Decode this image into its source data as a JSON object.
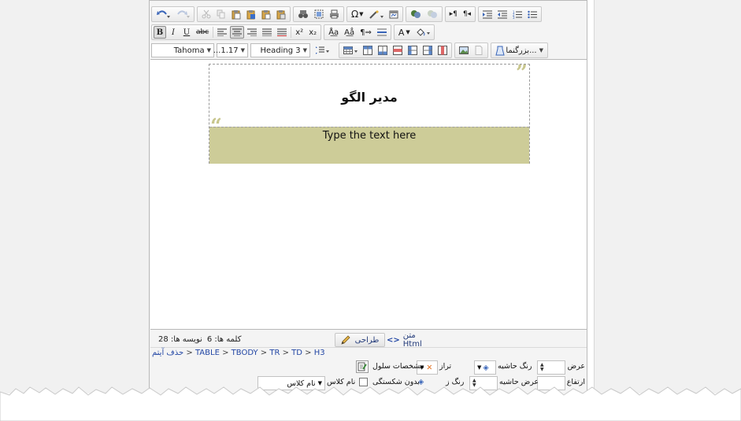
{
  "toolbar": {
    "row3": {
      "font_name": "Tahoma",
      "line_height": "...1.17",
      "heading": "Heading 3",
      "magnify": "بزرگنما..."
    }
  },
  "content": {
    "heading": "مدیر الگو",
    "cell_text": "Type the text here"
  },
  "status": {
    "word_count_label": "کلمه ها:",
    "word_count": "6",
    "char_count_label": "نویسه ها:",
    "char_count": "28",
    "design_label": "طراحی",
    "html_label": "متن Html"
  },
  "breadcrumb": {
    "remove_label": "حذف آیتم",
    "path": [
      "TABLE",
      "TBODY",
      "TR",
      "TD",
      "H3"
    ]
  },
  "props": {
    "width_label": "عرض",
    "height_label": "ارتفاع",
    "border_color_label": "رنگ حاشیه",
    "border_width_label": "عرض حاشیه",
    "align_label": "تراز",
    "bg_color_label": "رنگ ز",
    "cell_props_label": "مشخصات سلول",
    "nowrap_label": "بدون شکستگی",
    "class_label": "نام کلاس",
    "class_select": "نام کلاس"
  },
  "colors": {
    "cell_bg": "#cdcc98",
    "quote_mark": "#c8c68e",
    "link": "#2347a5"
  }
}
